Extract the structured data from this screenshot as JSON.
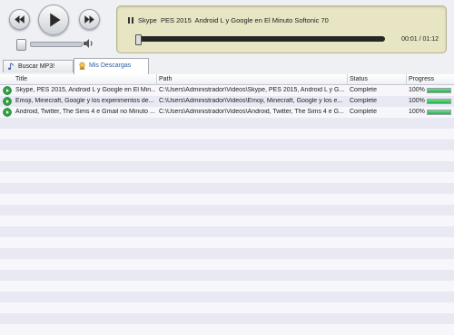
{
  "player": {
    "now_playing": "Skype  PES 2015  Android L y Google en El Minuto Softonic 70",
    "time": "00:01 / 01:12",
    "seek_position": 0.02,
    "volume": 0.22
  },
  "tabs": [
    {
      "label": "Buscar MP3!",
      "icon": "music-note-icon",
      "active": false
    },
    {
      "label": "Mis Descargas",
      "icon": "user-icon",
      "active": true
    }
  ],
  "table": {
    "columns": {
      "title": "Title",
      "path": "Path",
      "status": "Status",
      "progress": "Progress"
    },
    "rows": [
      {
        "title": "Skype, PES 2015, Android L y Google en El Min...",
        "path": "C:\\Users\\Administrador\\Videos\\Skype, PES 2015, Android L y G...",
        "status": "Complete",
        "progress": "100%",
        "progress_value": 1.0
      },
      {
        "title": "Emoji, Minecraft, Google y los experimentos de...",
        "path": "C:\\Users\\Administrador\\Videos\\Emoji, Minecraft, Google y los e...",
        "status": "Complete",
        "progress": "100%",
        "progress_value": 1.0
      },
      {
        "title": "Android, Twitter, The Sims 4 e Gmail no Minuto ...",
        "path": "C:\\Users\\Administrador\\Videos\\Android, Twitter, The Sims 4 e G...",
        "status": "Complete",
        "progress": "100%",
        "progress_value": 1.0
      }
    ]
  },
  "colors": {
    "now_playing_panel": "#e7e5c3",
    "progress_green": "#22b04a",
    "row_alt": "#e8e9f3",
    "active_tab_text": "#2e5aa8"
  }
}
